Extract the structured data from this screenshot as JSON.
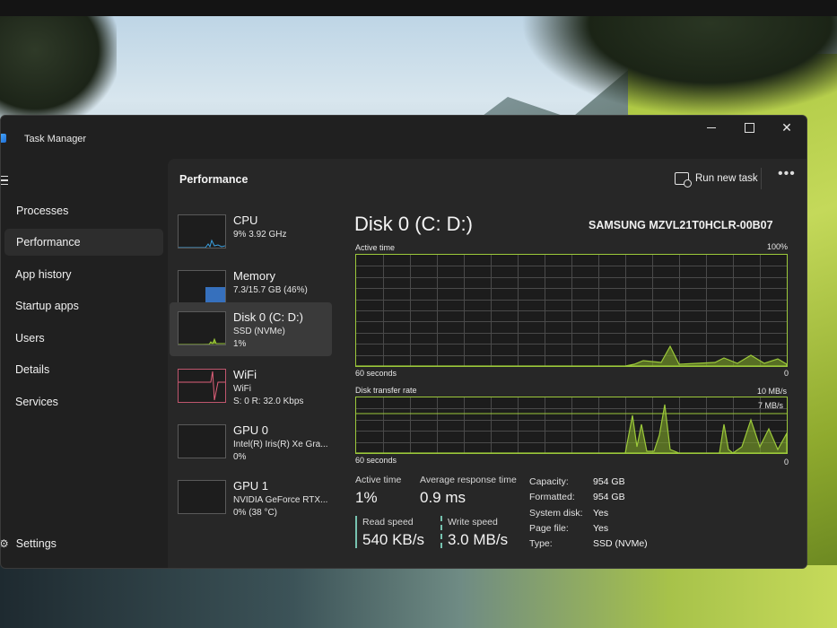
{
  "window": {
    "title": "Task Manager"
  },
  "sidebar": {
    "items": [
      {
        "label": "Processes",
        "icon": "processes-icon"
      },
      {
        "label": "Performance",
        "icon": "performance-icon",
        "active": true
      },
      {
        "label": "App history",
        "icon": "app-history-icon"
      },
      {
        "label": "Startup apps",
        "icon": "startup-apps-icon"
      },
      {
        "label": "Users",
        "icon": "users-icon"
      },
      {
        "label": "Details",
        "icon": "details-icon"
      },
      {
        "label": "Services",
        "icon": "services-icon"
      }
    ],
    "settings_label": "Settings"
  },
  "header": {
    "title": "Performance",
    "run_new_task": "Run new task",
    "more": "•••"
  },
  "devices": [
    {
      "name": "CPU",
      "sub": "9% 3.92 GHz",
      "sub2": ""
    },
    {
      "name": "Memory",
      "sub": "7.3/15.7 GB (46%)",
      "sub2": ""
    },
    {
      "name": "Disk 0 (C: D:)",
      "sub": "SSD (NVMe)",
      "sub2": "1%",
      "active": true
    },
    {
      "name": "WiFi",
      "sub": "WiFi",
      "sub2": "S: 0 R: 32.0 Kbps"
    },
    {
      "name": "GPU 0",
      "sub": "Intel(R) Iris(R) Xe Gra...",
      "sub2": "0%"
    },
    {
      "name": "GPU 1",
      "sub": "NVIDIA GeForce RTX...",
      "sub2": "0% (38 °C)"
    }
  ],
  "disk": {
    "title": "Disk 0 (C: D:)",
    "model": "SAMSUNG MZVL21T0HCLR-00B07",
    "active_time_graph": {
      "label": "Active time",
      "max": "100%",
      "x_label": "60 seconds",
      "min": "0"
    },
    "transfer_graph": {
      "label": "Disk transfer rate",
      "max": "10 MB/s",
      "marker": "7 MB/s",
      "x_label": "60 seconds",
      "min": "0"
    },
    "stats": {
      "active_time_label": "Active time",
      "active_time": "1%",
      "avg_resp_label": "Average response time",
      "avg_resp": "0.9 ms",
      "read_label": "Read speed",
      "read": "540 KB/s",
      "write_label": "Write speed",
      "write": "3.0 MB/s"
    },
    "properties": [
      {
        "key": "Capacity:",
        "value": "954 GB"
      },
      {
        "key": "Formatted:",
        "value": "954 GB"
      },
      {
        "key": "System disk:",
        "value": "Yes"
      },
      {
        "key": "Page file:",
        "value": "Yes"
      },
      {
        "key": "Type:",
        "value": "SSD (NVMe)"
      }
    ],
    "colors": {
      "disk_line": "#9cc93a",
      "disk_fill": "#7fa52a",
      "cpu": "#3aa0e0",
      "memory": "#3b7fd9",
      "wifi": "#e0607a"
    }
  }
}
